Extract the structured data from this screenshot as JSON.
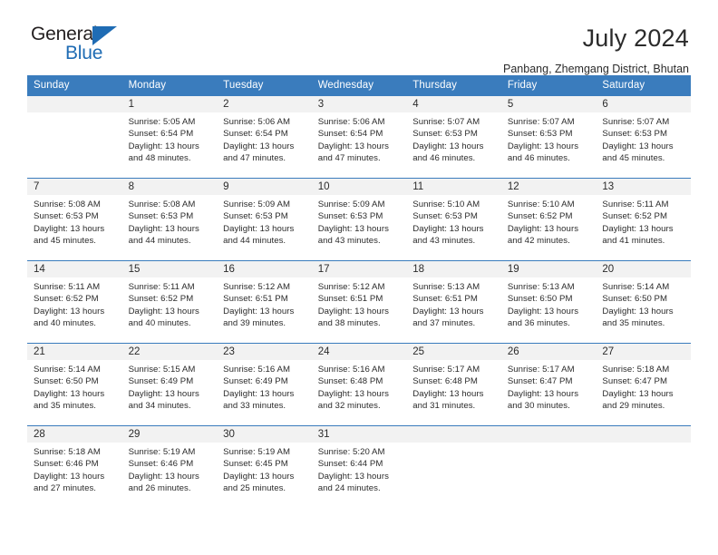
{
  "brand": {
    "line1": "General",
    "line2": "Blue",
    "accent_color": "#1f6cb4"
  },
  "header": {
    "title": "July 2024",
    "subtitle": "Panbang, Zhemgang District, Bhutan"
  },
  "calendar": {
    "header_bg": "#3a7cbd",
    "daynum_bg": "#f2f2f2",
    "weekday_headers": [
      "Sunday",
      "Monday",
      "Tuesday",
      "Wednesday",
      "Thursday",
      "Friday",
      "Saturday"
    ],
    "weeks": [
      [
        {
          "day": "",
          "lines": []
        },
        {
          "day": "1",
          "lines": [
            "Sunrise: 5:05 AM",
            "Sunset: 6:54 PM",
            "Daylight: 13 hours",
            "and 48 minutes."
          ]
        },
        {
          "day": "2",
          "lines": [
            "Sunrise: 5:06 AM",
            "Sunset: 6:54 PM",
            "Daylight: 13 hours",
            "and 47 minutes."
          ]
        },
        {
          "day": "3",
          "lines": [
            "Sunrise: 5:06 AM",
            "Sunset: 6:54 PM",
            "Daylight: 13 hours",
            "and 47 minutes."
          ]
        },
        {
          "day": "4",
          "lines": [
            "Sunrise: 5:07 AM",
            "Sunset: 6:53 PM",
            "Daylight: 13 hours",
            "and 46 minutes."
          ]
        },
        {
          "day": "5",
          "lines": [
            "Sunrise: 5:07 AM",
            "Sunset: 6:53 PM",
            "Daylight: 13 hours",
            "and 46 minutes."
          ]
        },
        {
          "day": "6",
          "lines": [
            "Sunrise: 5:07 AM",
            "Sunset: 6:53 PM",
            "Daylight: 13 hours",
            "and 45 minutes."
          ]
        }
      ],
      [
        {
          "day": "7",
          "lines": [
            "Sunrise: 5:08 AM",
            "Sunset: 6:53 PM",
            "Daylight: 13 hours",
            "and 45 minutes."
          ]
        },
        {
          "day": "8",
          "lines": [
            "Sunrise: 5:08 AM",
            "Sunset: 6:53 PM",
            "Daylight: 13 hours",
            "and 44 minutes."
          ]
        },
        {
          "day": "9",
          "lines": [
            "Sunrise: 5:09 AM",
            "Sunset: 6:53 PM",
            "Daylight: 13 hours",
            "and 44 minutes."
          ]
        },
        {
          "day": "10",
          "lines": [
            "Sunrise: 5:09 AM",
            "Sunset: 6:53 PM",
            "Daylight: 13 hours",
            "and 43 minutes."
          ]
        },
        {
          "day": "11",
          "lines": [
            "Sunrise: 5:10 AM",
            "Sunset: 6:53 PM",
            "Daylight: 13 hours",
            "and 43 minutes."
          ]
        },
        {
          "day": "12",
          "lines": [
            "Sunrise: 5:10 AM",
            "Sunset: 6:52 PM",
            "Daylight: 13 hours",
            "and 42 minutes."
          ]
        },
        {
          "day": "13",
          "lines": [
            "Sunrise: 5:11 AM",
            "Sunset: 6:52 PM",
            "Daylight: 13 hours",
            "and 41 minutes."
          ]
        }
      ],
      [
        {
          "day": "14",
          "lines": [
            "Sunrise: 5:11 AM",
            "Sunset: 6:52 PM",
            "Daylight: 13 hours",
            "and 40 minutes."
          ]
        },
        {
          "day": "15",
          "lines": [
            "Sunrise: 5:11 AM",
            "Sunset: 6:52 PM",
            "Daylight: 13 hours",
            "and 40 minutes."
          ]
        },
        {
          "day": "16",
          "lines": [
            "Sunrise: 5:12 AM",
            "Sunset: 6:51 PM",
            "Daylight: 13 hours",
            "and 39 minutes."
          ]
        },
        {
          "day": "17",
          "lines": [
            "Sunrise: 5:12 AM",
            "Sunset: 6:51 PM",
            "Daylight: 13 hours",
            "and 38 minutes."
          ]
        },
        {
          "day": "18",
          "lines": [
            "Sunrise: 5:13 AM",
            "Sunset: 6:51 PM",
            "Daylight: 13 hours",
            "and 37 minutes."
          ]
        },
        {
          "day": "19",
          "lines": [
            "Sunrise: 5:13 AM",
            "Sunset: 6:50 PM",
            "Daylight: 13 hours",
            "and 36 minutes."
          ]
        },
        {
          "day": "20",
          "lines": [
            "Sunrise: 5:14 AM",
            "Sunset: 6:50 PM",
            "Daylight: 13 hours",
            "and 35 minutes."
          ]
        }
      ],
      [
        {
          "day": "21",
          "lines": [
            "Sunrise: 5:14 AM",
            "Sunset: 6:50 PM",
            "Daylight: 13 hours",
            "and 35 minutes."
          ]
        },
        {
          "day": "22",
          "lines": [
            "Sunrise: 5:15 AM",
            "Sunset: 6:49 PM",
            "Daylight: 13 hours",
            "and 34 minutes."
          ]
        },
        {
          "day": "23",
          "lines": [
            "Sunrise: 5:16 AM",
            "Sunset: 6:49 PM",
            "Daylight: 13 hours",
            "and 33 minutes."
          ]
        },
        {
          "day": "24",
          "lines": [
            "Sunrise: 5:16 AM",
            "Sunset: 6:48 PM",
            "Daylight: 13 hours",
            "and 32 minutes."
          ]
        },
        {
          "day": "25",
          "lines": [
            "Sunrise: 5:17 AM",
            "Sunset: 6:48 PM",
            "Daylight: 13 hours",
            "and 31 minutes."
          ]
        },
        {
          "day": "26",
          "lines": [
            "Sunrise: 5:17 AM",
            "Sunset: 6:47 PM",
            "Daylight: 13 hours",
            "and 30 minutes."
          ]
        },
        {
          "day": "27",
          "lines": [
            "Sunrise: 5:18 AM",
            "Sunset: 6:47 PM",
            "Daylight: 13 hours",
            "and 29 minutes."
          ]
        }
      ],
      [
        {
          "day": "28",
          "lines": [
            "Sunrise: 5:18 AM",
            "Sunset: 6:46 PM",
            "Daylight: 13 hours",
            "and 27 minutes."
          ]
        },
        {
          "day": "29",
          "lines": [
            "Sunrise: 5:19 AM",
            "Sunset: 6:46 PM",
            "Daylight: 13 hours",
            "and 26 minutes."
          ]
        },
        {
          "day": "30",
          "lines": [
            "Sunrise: 5:19 AM",
            "Sunset: 6:45 PM",
            "Daylight: 13 hours",
            "and 25 minutes."
          ]
        },
        {
          "day": "31",
          "lines": [
            "Sunrise: 5:20 AM",
            "Sunset: 6:44 PM",
            "Daylight: 13 hours",
            "and 24 minutes."
          ]
        },
        {
          "day": "",
          "lines": []
        },
        {
          "day": "",
          "lines": []
        },
        {
          "day": "",
          "lines": []
        }
      ]
    ]
  }
}
